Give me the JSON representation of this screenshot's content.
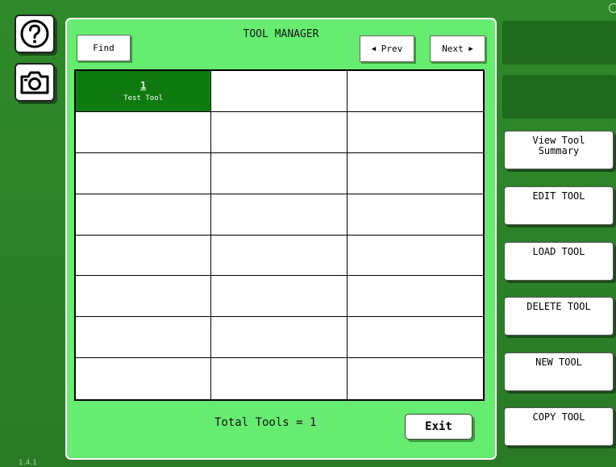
{
  "window": {
    "title": "TOOL MANAGER",
    "version": "1.4.1"
  },
  "toolbar": {
    "find_label": "Find",
    "prev_label": "Prev",
    "next_label": "Next"
  },
  "icons": {
    "help": "help-question-icon",
    "camera": "camera-icon"
  },
  "tools": [
    {
      "number": "1",
      "name": "Test Tool",
      "selected": true
    }
  ],
  "grid": {
    "columns": 3,
    "rows": 8
  },
  "footer": {
    "total_label": "Total Tools = 1",
    "exit_label": "Exit"
  },
  "side_buttons": [
    {
      "label": "View Tool Summary"
    },
    {
      "label": "EDIT TOOL"
    },
    {
      "label": "LOAD TOOL"
    },
    {
      "label": "DELETE TOOL"
    },
    {
      "label": "NEW TOOL"
    },
    {
      "label": "COPY TOOL"
    }
  ],
  "colors": {
    "background": "#2e7d2a",
    "panel": "#66ec70",
    "selected_cell": "#0f7a0f",
    "slot": "#1f6a1c"
  }
}
